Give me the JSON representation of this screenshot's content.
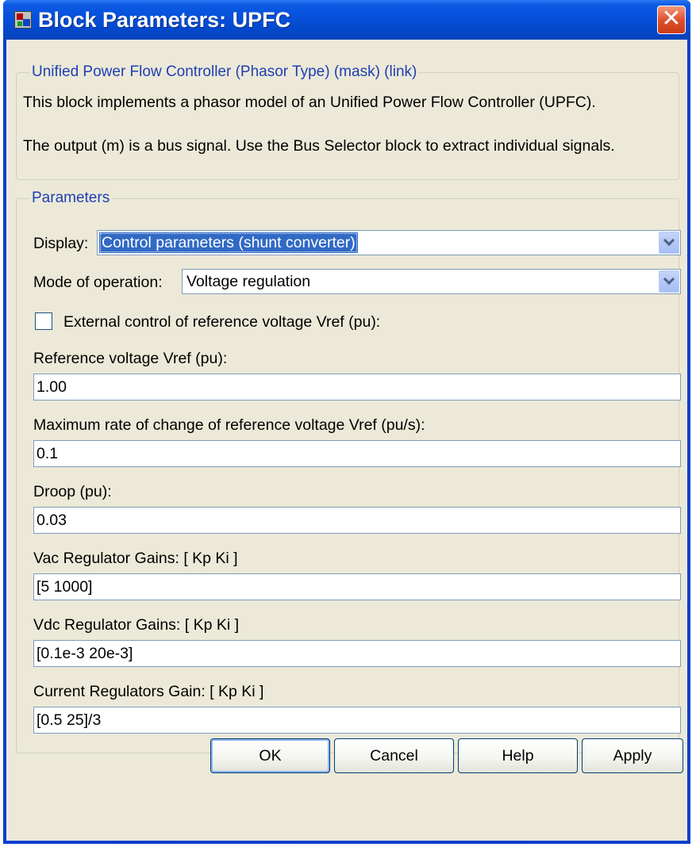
{
  "window": {
    "title": "Block Parameters: UPFC",
    "close_glyph": "✕"
  },
  "description": {
    "legend": "Unified Power Flow Controller (Phasor Type) (mask) (link)",
    "line1": "This block implements a phasor model of an Unified Power Flow Controller (UPFC).",
    "line2": "The output (m) is a bus signal. Use the Bus Selector block to extract individual signals."
  },
  "parameters": {
    "legend": "Parameters",
    "display": {
      "label": "Display:",
      "value": "Control parameters (shunt converter)"
    },
    "mode": {
      "label": "Mode of operation:",
      "value": "Voltage regulation"
    },
    "external_control": {
      "label": "External control of reference voltage Vref (pu):",
      "checked": false
    },
    "fields": [
      {
        "label": "Reference voltage Vref (pu):",
        "value": "1.00"
      },
      {
        "label": "Maximum rate of change of reference voltage Vref (pu/s):",
        "value": "0.1"
      },
      {
        "label": "Droop (pu):",
        "value": "0.03"
      },
      {
        "label": "Vac Regulator Gains: [ Kp  Ki ]",
        "value": "[5 1000]"
      },
      {
        "label": "Vdc Regulator Gains: [ Kp  Ki ]",
        "value": "[0.1e-3 20e-3]"
      },
      {
        "label": "Current Regulators Gain: [ Kp Ki ]",
        "value": "[0.5 25]/3"
      }
    ]
  },
  "buttons": {
    "ok": "OK",
    "cancel": "Cancel",
    "help": "Help",
    "apply": "Apply"
  },
  "colors": {
    "title_bar": "#0650da",
    "legend_text": "#1f3fb4",
    "selection": "#316ac5",
    "dialog_bg": "#ece9d8",
    "close_button": "#e0502c"
  }
}
